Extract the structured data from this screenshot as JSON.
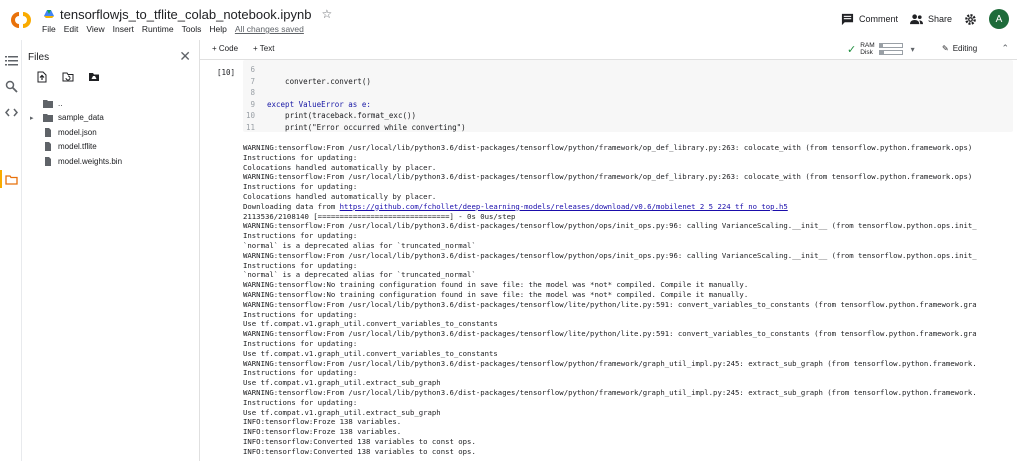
{
  "header": {
    "notebook_title": "tensorflowjs_to_tflite_colab_notebook.ipynb",
    "menu": [
      "File",
      "Edit",
      "View",
      "Insert",
      "Runtime",
      "Tools",
      "Help"
    ],
    "saved_status": "All changes saved",
    "comment_label": "Comment",
    "share_label": "Share",
    "avatar_initial": "A"
  },
  "files": {
    "title": "Files",
    "tree": [
      {
        "name": "..",
        "kind": "folder",
        "caret": ""
      },
      {
        "name": "sample_data",
        "kind": "folder",
        "caret": "▸"
      },
      {
        "name": "model.json",
        "kind": "file",
        "caret": ""
      },
      {
        "name": "model.tflite",
        "kind": "file",
        "caret": ""
      },
      {
        "name": "model.weights.bin",
        "kind": "file",
        "caret": ""
      }
    ]
  },
  "toolbar": {
    "code_label": "+ Code",
    "text_label": "+ Text",
    "ram_label": "RAM",
    "disk_label": "Disk",
    "ram_fraction": 0.15,
    "disk_fraction": 0.2,
    "editing_label": "Editing"
  },
  "cell": {
    "exec_count": "[10]",
    "lines": [
      {
        "n": "6",
        "text": ""
      },
      {
        "n": "7",
        "text": "    converter.convert()"
      },
      {
        "n": "8",
        "text": ""
      },
      {
        "n": "9",
        "text": "except ValueError as e:"
      },
      {
        "n": "10",
        "text": "    print(traceback.format_exc())"
      },
      {
        "n": "11",
        "text": "    print(\"Error occurred while converting\")"
      }
    ]
  },
  "output": [
    "WARNING:tensorflow:From /usr/local/lib/python3.6/dist-packages/tensorflow/python/framework/op_def_library.py:263: colocate_with (from tensorflow.python.framework.ops)",
    "Instructions for updating:",
    "Colocations handled automatically by placer.",
    "WARNING:tensorflow:From /usr/local/lib/python3.6/dist-packages/tensorflow/python/framework/op_def_library.py:263: colocate_with (from tensorflow.python.framework.ops)",
    "Instructions for updating:",
    "Colocations handled automatically by placer.",
    "Downloading data from ",
    "2113536/2108140 [==============================] - 0s 0us/step",
    "WARNING:tensorflow:From /usr/local/lib/python3.6/dist-packages/tensorflow/python/ops/init_ops.py:96: calling VarianceScaling.__init__ (from tensorflow.python.ops.init_",
    "Instructions for updating:",
    "`normal` is a deprecated alias for `truncated_normal`",
    "WARNING:tensorflow:From /usr/local/lib/python3.6/dist-packages/tensorflow/python/ops/init_ops.py:96: calling VarianceScaling.__init__ (from tensorflow.python.ops.init_",
    "Instructions for updating:",
    "`normal` is a deprecated alias for `truncated_normal`",
    "WARNING:tensorflow:No training configuration found in save file: the model was *not* compiled. Compile it manually.",
    "WARNING:tensorflow:No training configuration found in save file: the model was *not* compiled. Compile it manually.",
    "WARNING:tensorflow:From /usr/local/lib/python3.6/dist-packages/tensorflow/lite/python/lite.py:591: convert_variables_to_constants (from tensorflow.python.framework.gra",
    "Instructions for updating:",
    "Use tf.compat.v1.graph_util.convert_variables_to_constants",
    "WARNING:tensorflow:From /usr/local/lib/python3.6/dist-packages/tensorflow/lite/python/lite.py:591: convert_variables_to_constants (from tensorflow.python.framework.gra",
    "Instructions for updating:",
    "Use tf.compat.v1.graph_util.convert_variables_to_constants",
    "WARNING:tensorflow:From /usr/local/lib/python3.6/dist-packages/tensorflow/python/framework/graph_util_impl.py:245: extract_sub_graph (from tensorflow.python.framework.",
    "Instructions for updating:",
    "Use tf.compat.v1.graph_util.extract_sub_graph",
    "WARNING:tensorflow:From /usr/local/lib/python3.6/dist-packages/tensorflow/python/framework/graph_util_impl.py:245: extract_sub_graph (from tensorflow.python.framework.",
    "Instructions for updating:",
    "Use tf.compat.v1.graph_util.extract_sub_graph",
    "INFO:tensorflow:Froze 138 variables.",
    "INFO:tensorflow:Froze 138 variables.",
    "INFO:tensorflow:Converted 138 variables to const ops.",
    "INFO:tensorflow:Converted 138 variables to const ops."
  ],
  "download_link": "https://github.com/fchollet/deep-learning-models/releases/download/v0.6/mobilenet_2_5_224_tf_no_top.h5",
  "colors": {
    "logo_orange": "#f9ab00",
    "logo_dark": "#e8710a",
    "avatar_bg": "#1e6b3a",
    "ok_green": "#1e8e3e",
    "link": "#1a0dab"
  }
}
